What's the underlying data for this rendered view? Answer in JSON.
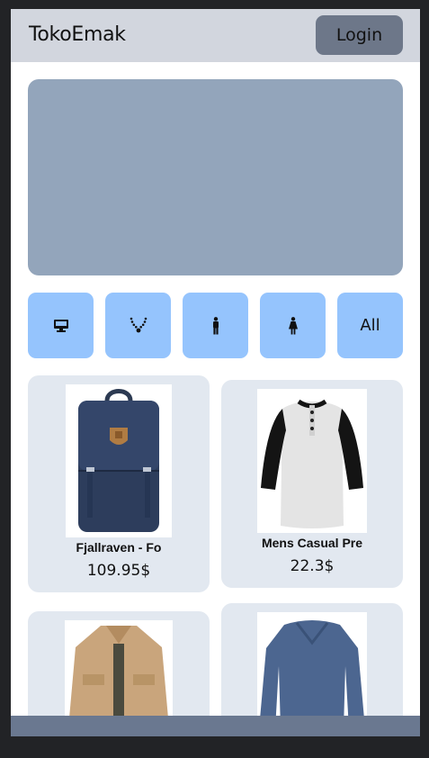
{
  "header": {
    "brand": "TokoEmak",
    "login_label": "Login"
  },
  "categories": [
    {
      "icon": "computer-icon"
    },
    {
      "icon": "necklace-icon"
    },
    {
      "icon": "male-icon"
    },
    {
      "icon": "female-icon"
    },
    {
      "label": "All"
    }
  ],
  "products": [
    {
      "name": "Fjallraven - Fo",
      "price": "109.95$",
      "image": "backpack"
    },
    {
      "name": "Mens Casual Pre",
      "price": "22.3$",
      "image": "raglan-tshirt"
    },
    {
      "name": "",
      "price": "",
      "image": "jacket"
    },
    {
      "name": "",
      "price": "",
      "image": "long-sleeve-shirt"
    }
  ],
  "colors": {
    "header_bg": "#d2d6de",
    "login_bg": "#6d7789",
    "banner_bg": "#93a5bb",
    "category_bg": "#95c4fd",
    "card_bg": "#e2e8f0",
    "footer_bg": "#6a7890"
  }
}
